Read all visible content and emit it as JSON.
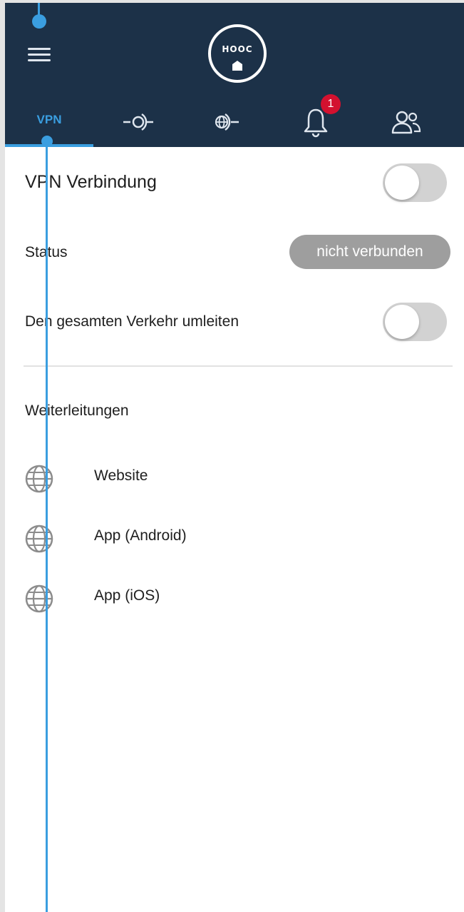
{
  "header": {
    "logo_text": "HOOC",
    "notification_count": "1",
    "tabs": [
      {
        "label": "VPN",
        "icon": "vpn-tab",
        "active": true
      },
      {
        "label": "",
        "icon": "port-forward-icon",
        "active": false
      },
      {
        "label": "",
        "icon": "globe-forward-icon",
        "active": false
      },
      {
        "label": "",
        "icon": "bell-icon",
        "active": false
      },
      {
        "label": "",
        "icon": "users-icon",
        "active": false
      }
    ]
  },
  "vpn": {
    "connection_label": "VPN Verbindung",
    "connection_on": false,
    "status_label": "Status",
    "status_value": "nicht verbunden",
    "redirect_label": "Den gesamten Verkehr umleiten",
    "redirect_on": false
  },
  "forwards": {
    "title": "Weiterleitungen",
    "items": [
      {
        "label": "Website",
        "icon": "globe-icon"
      },
      {
        "label": "App (Android)",
        "icon": "globe-icon"
      },
      {
        "label": "App (iOS)",
        "icon": "globe-icon"
      }
    ]
  },
  "colors": {
    "header_bg": "#1c3148",
    "accent": "#3a9ee0",
    "badge": "#d3112f",
    "status_pill": "#9e9e9e",
    "toggle_off": "#d2d2d2"
  }
}
